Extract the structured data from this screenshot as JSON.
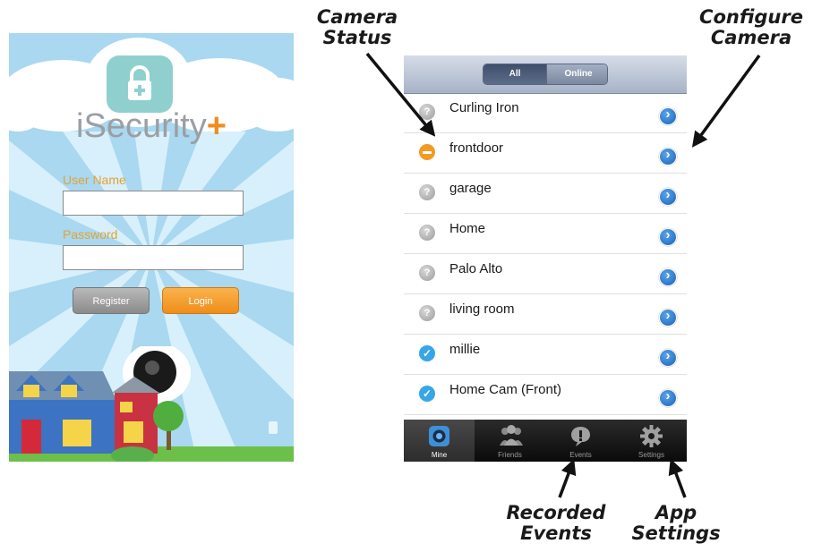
{
  "login": {
    "brand_name": "iSecurity",
    "brand_plus": "+",
    "username_label": "User Name",
    "username_value": "",
    "password_label": "Password",
    "password_value": "",
    "register_label": "Register",
    "login_label": "Login",
    "colors": {
      "accent": "#f28c1e",
      "sky": "#bfe4f5",
      "label": "#e3a233"
    }
  },
  "camera_list": {
    "segments": [
      "All",
      "Online"
    ],
    "selected_segment": "All",
    "cameras": [
      {
        "name": "Curling Iron",
        "status": "unknown"
      },
      {
        "name": "frontdoor",
        "status": "busy"
      },
      {
        "name": "garage",
        "status": "unknown"
      },
      {
        "name": "Home",
        "status": "unknown"
      },
      {
        "name": "Palo Alto",
        "status": "unknown"
      },
      {
        "name": "living room",
        "status": "unknown"
      },
      {
        "name": "millie",
        "status": "online"
      },
      {
        "name": "Home Cam (Front)",
        "status": "online"
      }
    ],
    "tabs": [
      {
        "label": "Mine",
        "icon": "camera-icon"
      },
      {
        "label": "Friends",
        "icon": "people-icon"
      },
      {
        "label": "Events",
        "icon": "alert-icon"
      },
      {
        "label": "Settings",
        "icon": "gear-icon"
      }
    ],
    "selected_tab": "Mine"
  },
  "annotations": {
    "camera_status": [
      "Camera",
      "Status"
    ],
    "configure_camera": [
      "Configure",
      "Camera"
    ],
    "recorded_events": [
      "Recorded",
      "Events"
    ],
    "app_settings": [
      "App",
      "Settings"
    ]
  }
}
